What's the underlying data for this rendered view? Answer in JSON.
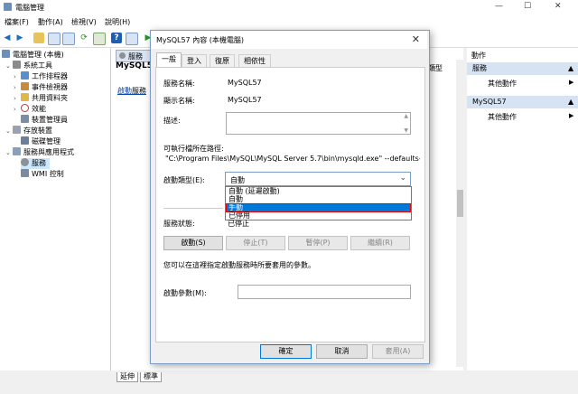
{
  "window": {
    "title": "電腦管理",
    "min": "—",
    "max": "☐",
    "close": "✕"
  },
  "menu": [
    "檔案(F)",
    "動作(A)",
    "檢視(V)",
    "說明(H)"
  ],
  "tree": {
    "root": "電腦管理 (本機)",
    "system_tools": "系統工具",
    "task_scheduler": "工作排程器",
    "event_viewer": "事件檢視器",
    "shared_folders": "共用資料夾",
    "performance": "效能",
    "device_manager": "裝置管理員",
    "storage": "存放裝置",
    "disk_management": "磁碟管理",
    "services_apps": "服務與應用程式",
    "services": "服務",
    "wmi": "WMI 控制"
  },
  "center": {
    "tab": "服務",
    "heading": "MySQL57",
    "start_link": "啟動",
    "start_suffix": "服務",
    "col_header": "類型",
    "bottom_tabs": [
      "延伸",
      "標準"
    ]
  },
  "actions": {
    "header1": "動作",
    "group1": "服務",
    "more1": "其他動作",
    "group2": "MySQL57",
    "more2": "其他動作"
  },
  "dialog": {
    "title": "MySQL57 內容 (本機電腦)",
    "close": "✕",
    "tabs": [
      "一般",
      "登入",
      "復原",
      "相依性"
    ],
    "service_name_label": "服務名稱:",
    "service_name": "MySQL57",
    "display_name_label": "顯示名稱:",
    "display_name": "MySQL57",
    "description_label": "描述:",
    "path_label": "可執行檔所在路徑:",
    "path": "\"C:\\Program Files\\MySQL\\MySQL Server 5.7\\bin\\mysqld.exe\" --defaults-file",
    "startup_type_label": "啟動類型(E):",
    "startup_type_value": "自動",
    "startup_options": [
      "自動 (延遲啟動)",
      "自動",
      "手動",
      "已停用"
    ],
    "service_status_label": "服務狀態:",
    "service_status": "已停止",
    "btn_start": "啟動(S)",
    "btn_stop": "停止(T)",
    "btn_pause": "暫停(P)",
    "btn_resume": "繼續(R)",
    "param_hint": "您可以在這裡指定啟動服務時所要套用的參數。",
    "start_params_label": "啟動參數(M):",
    "ok": "確定",
    "cancel": "取消",
    "apply": "套用(A)"
  }
}
